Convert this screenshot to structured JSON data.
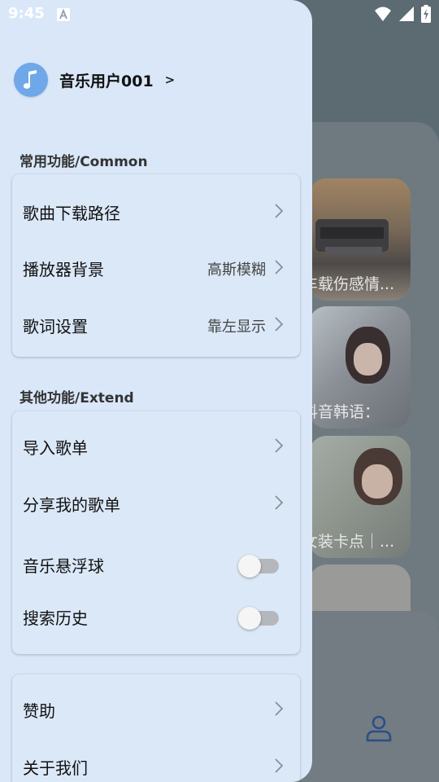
{
  "status_bar": {
    "time": "9:45"
  },
  "user": {
    "name": "音乐用户001",
    "arrow": ">"
  },
  "sections": {
    "common_title": "常用功能/Common",
    "extend_title": "其他功能/Extend"
  },
  "common_items": [
    {
      "label": "歌曲下载路径",
      "value": ""
    },
    {
      "label": "播放器背景",
      "value": "高斯模糊"
    },
    {
      "label": "歌词设置",
      "value": "靠左显示"
    }
  ],
  "extend_items": [
    {
      "label": "导入歌单"
    },
    {
      "label": "分享我的歌单"
    },
    {
      "label": "音乐悬浮球",
      "toggle": false
    },
    {
      "label": "搜索历史",
      "toggle": false
    }
  ],
  "other_items": [
    {
      "label": "赞助"
    },
    {
      "label": "关于我们"
    }
  ],
  "background": {
    "card_captions": [
      "车载伤感情...",
      "抖音韩语：",
      "女装卡点｜..."
    ]
  },
  "colors": {
    "drawer_bg": "#d9e7f8",
    "avatar": "#6ea8e8",
    "toggle_off": "#b4b8bc"
  },
  "icons": [
    "music-note-icon",
    "chevron-right-icon",
    "user-icon",
    "wifi-icon",
    "signal-icon",
    "battery-icon"
  ]
}
